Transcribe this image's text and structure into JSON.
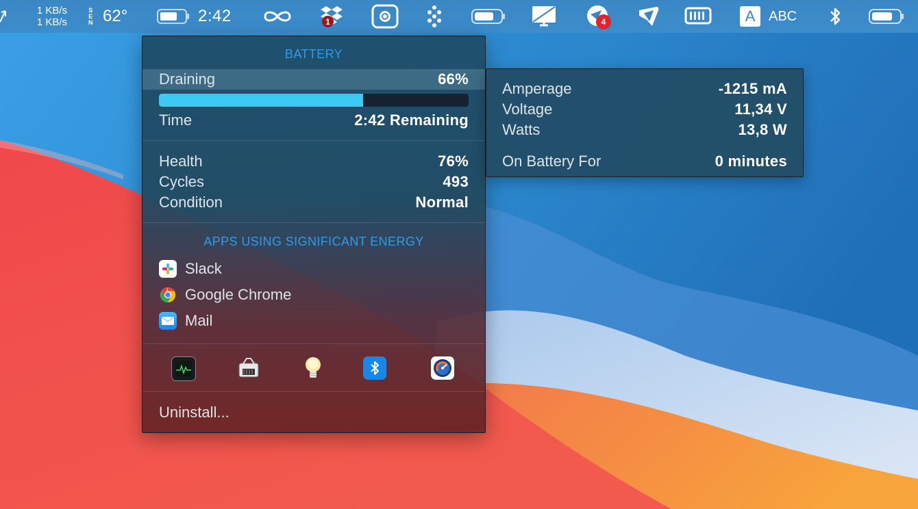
{
  "menubar": {
    "net_up": "1 KB/s",
    "net_down": "1 KB/s",
    "compass": [
      "S",
      "E",
      "N"
    ],
    "temperature": "62°",
    "clock": "2:42",
    "dropbox_badge": "1",
    "notification_badge": "4",
    "ime_letter": "A",
    "ime_label": "ABC"
  },
  "battery_panel": {
    "title": "BATTERY",
    "state_label": "Draining",
    "charge_percent": "66%",
    "charge_level": 0.66,
    "time_label": "Time",
    "time_value": "2:42 Remaining",
    "health_label": "Health",
    "health_value": "76%",
    "cycles_label": "Cycles",
    "cycles_value": "493",
    "condition_label": "Condition",
    "condition_value": "Normal",
    "apps_title": "APPS USING SIGNIFICANT ENERGY",
    "apps": [
      {
        "name": "Slack",
        "icon": "slack-icon"
      },
      {
        "name": "Google Chrome",
        "icon": "chrome-icon"
      },
      {
        "name": "Mail",
        "icon": "mail-icon"
      }
    ],
    "tools": [
      "activity-monitor-icon",
      "system-information-icon",
      "light-bulb-icon",
      "bluetooth-icon",
      "istat-menus-icon"
    ],
    "uninstall_label": "Uninstall..."
  },
  "details_panel": {
    "amperage_label": "Amperage",
    "amperage_value": "-1215 mA",
    "voltage_label": "Voltage",
    "voltage_value": "11,34 V",
    "watts_label": "Watts",
    "watts_value": "13,8 W",
    "on_battery_label": "On Battery For",
    "on_battery_value": "0 minutes"
  },
  "colors": {
    "accent_blue": "#2f9bea",
    "bar_fill": "#3fc8f4",
    "menubar": "#3a87c4",
    "badge_red": "#e0242a"
  }
}
